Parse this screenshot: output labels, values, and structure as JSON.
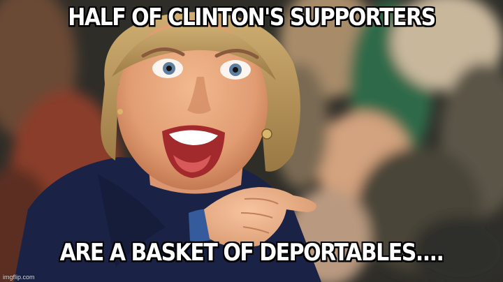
{
  "meme": {
    "top_text": "HALF OF CLINTON'S SUPPORTERS",
    "bottom_text": "ARE A BASKET OF DEPORTABLES....",
    "watermark": "imgflip.com"
  },
  "colors": {
    "caption_fill": "#ffffff",
    "caption_outline": "#000000",
    "jacket": "#1a2346",
    "hair": "#b89457",
    "background_crowd": "#3b3a2e"
  }
}
